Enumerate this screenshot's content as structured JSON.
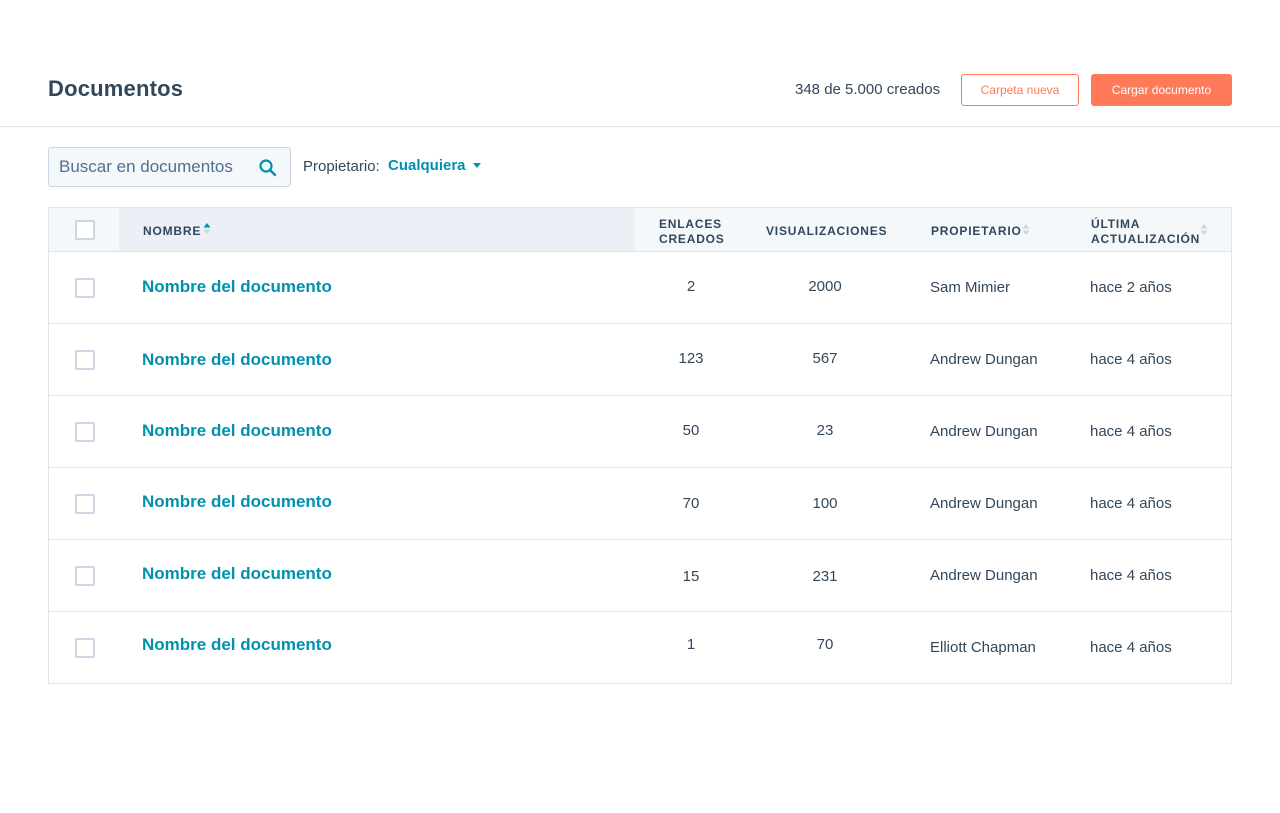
{
  "header": {
    "title": "Documentos",
    "count_text": "348 de 5.000 creados",
    "new_folder_label": "Carpeta nueva",
    "upload_label": "Cargar documento"
  },
  "filters": {
    "search_placeholder": "Buscar en documentos",
    "owner_label": "Propietario:",
    "owner_value": "Cualquiera"
  },
  "table": {
    "columns": {
      "name": "NOMBRE",
      "links_line1": "ENLACES",
      "links_line2": "CREADOS",
      "views": "VISUALIZACIONES",
      "owner": "PROPIETARIO",
      "updated_line1": "ÚLTIMA",
      "updated_line2": "ACTUALIZACIÓN"
    },
    "rows": [
      {
        "name": "Nombre del documento",
        "links": "2",
        "views": "2000",
        "owner": "Sam Mimier",
        "updated": "hace 2 años"
      },
      {
        "name": "Nombre del documento",
        "links": "123",
        "views": "567",
        "owner": "Andrew Dungan",
        "updated": "hace 4 años"
      },
      {
        "name": "Nombre del documento",
        "links": "50",
        "views": "23",
        "owner": "Andrew Dungan",
        "updated": "hace 4 años"
      },
      {
        "name": "Nombre del documento",
        "links": "70",
        "views": "100",
        "owner": "Andrew Dungan",
        "updated": "hace 4 años"
      },
      {
        "name": "Nombre del documento",
        "links": "15",
        "views": "231",
        "owner": "Andrew Dungan",
        "updated": "hace 4 años"
      },
      {
        "name": "Nombre del documento",
        "links": "1",
        "views": "70",
        "owner": "Elliott Chapman",
        "updated": "hace 4 años"
      }
    ]
  },
  "colors": {
    "accent": "#ff7a59",
    "link": "#0091ae",
    "text": "#33475b",
    "border": "#dfe3eb"
  },
  "icons": {
    "search": "search-icon",
    "sort_asc": "sort-ascending-icon",
    "sort": "sort-icon",
    "caret": "caret-down-icon"
  }
}
